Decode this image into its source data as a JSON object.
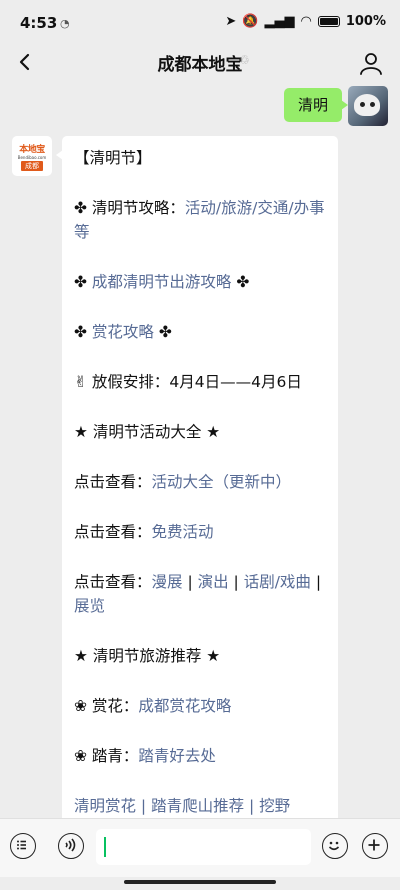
{
  "status": {
    "time": "4:53",
    "battery": "100"
  },
  "nav": {
    "title": "成都本地宝"
  },
  "sent": {
    "text": "清明"
  },
  "bot_logo": {
    "top": "本地宝",
    "url": "Bendibao.com",
    "city": "成都"
  },
  "reply": {
    "heading": "【清明节】",
    "line1_prefix": "✤ 清明节攻略：",
    "line1_link": "活动/旅游/交通/办事等",
    "line2_link": "成都清明节出游攻略",
    "line3_link": "赏花攻略",
    "line4": "✌ 放假安排：4月4日——4月6日",
    "section1": "★ 清明节活动大全 ★",
    "line5_prefix": "点击查看：",
    "line5_link": "活动大全（更新中）",
    "line6_prefix": "点击查看：",
    "line6_link": "免费活动",
    "line7_prefix": "点击查看：",
    "line7_links": [
      "漫展",
      "演出",
      "话剧/戏曲",
      "展览"
    ],
    "section2": "★ 清明节旅游推荐 ★",
    "line8_prefix": "❀ 赏花：",
    "line8_link": "成都赏花攻略",
    "line9_prefix": "❀ 踏青：",
    "line9_link": "踏青好去处",
    "line10_partial": "清明赏花 | 踏青爬山推荐 | 挖野"
  },
  "colors": {
    "link": "#576b95",
    "sent_bubble": "#95ec69",
    "cursor": "#07c160",
    "logo": "#e05a1b"
  }
}
